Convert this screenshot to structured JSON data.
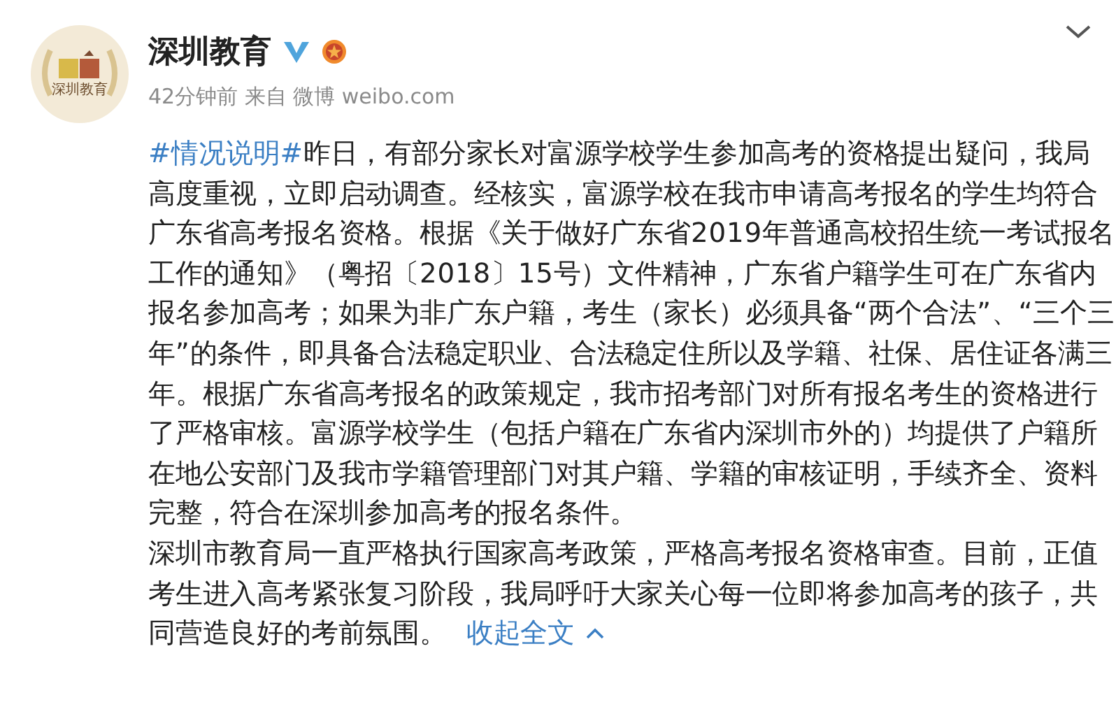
{
  "post": {
    "avatar_text": "深圳教育",
    "author": "深圳教育",
    "meta": "42分钟前 来自 微博 weibo.com",
    "paragraphs": [
      {
        "hashtag": "#情况说明#",
        "text": "昨日，有部分家长对富源学校学生参加高考的资格提出疑问，我局高度重视，立即启动调查。经核实，富源学校在我市申请高考报名的学生均符合广东省高考报名资格。根据《关于做好广东省2019年普通高校招生统一考试报名工作的通知》（粤招〔2018〕15号）文件精神，广东省户籍学生可在广东省内报名参加高考；如果为非广东户籍，考生（家长）必须具备“两个合法”、“三个三年”的条件，即具备合法稳定职业、合法稳定住所以及学籍、社保、居住证各满三年。根据广东省高考报名的政策规定，我市招考部门对所有报名考生的资格进行了严格审核。富源学校学生（包括户籍在广东省内深圳市外的）均提供了户籍所在地公安部门及我市学籍管理部门对其户籍、学籍的审核证明，手续齐全、资料完整，符合在深圳参加高考的报名条件。"
      },
      {
        "text": "深圳市教育局一直严格执行国家高考政策，严格高考报名资格审查。目前，正值考生进入高考紧张复习阶段，我局呼吁大家关心每一位即将参加高考的孩子，共同营造良好的考前氛围。"
      }
    ],
    "collapse_link": "收起全文"
  }
}
